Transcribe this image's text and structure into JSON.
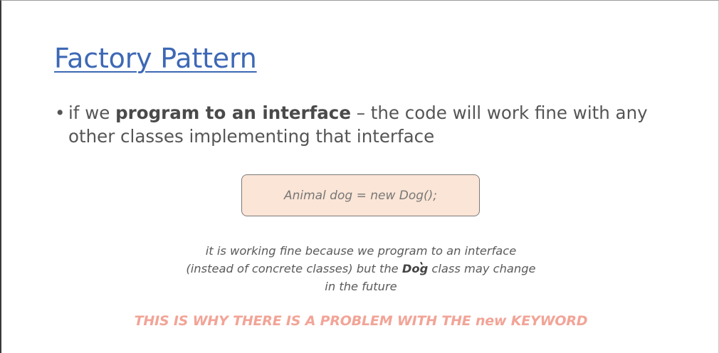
{
  "slide": {
    "title": "Factory Pattern",
    "bullet": {
      "marker": "•",
      "pre": "if we ",
      "bold": "program to an interface",
      "post": " – the code will work fine with any other classes implementing that interface"
    },
    "code": "Animal dog = new Dog();",
    "explanation": {
      "pre": "it is working fine because we program to an interface (instead of concrete classes) but the ",
      "bold": "Dog",
      "post": " class may change in the future"
    },
    "warning": "THIS IS WHY THERE IS A PROBLEM WITH THE new KEYWORD"
  },
  "colors": {
    "title": "#3d68b5",
    "code_box_fill": "#fbe5d6",
    "warning": "#f2a497"
  }
}
